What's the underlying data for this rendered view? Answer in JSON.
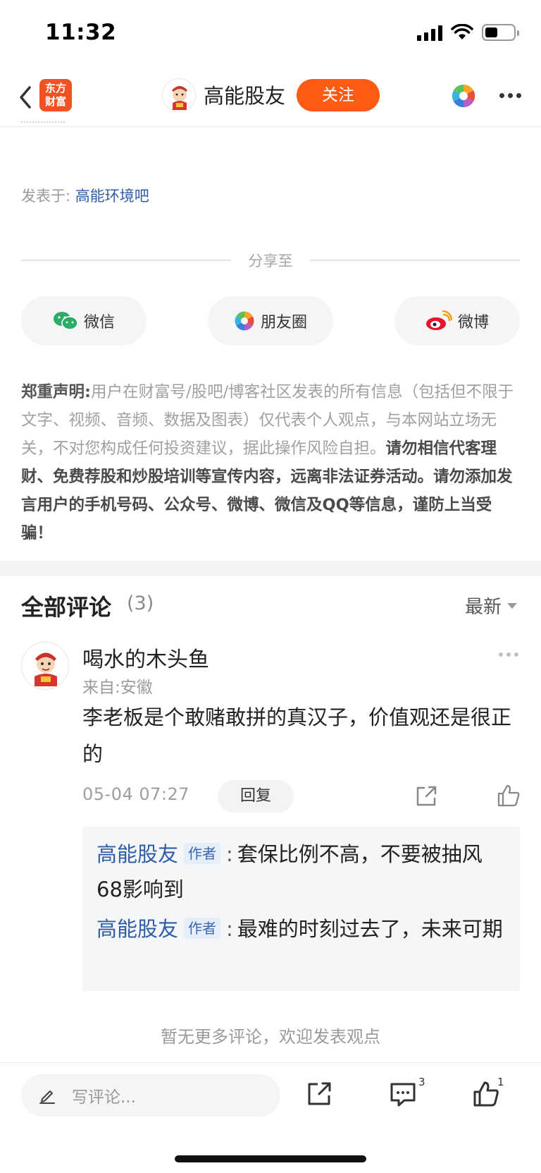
{
  "status_bar": {
    "time": "11:32"
  },
  "nav": {
    "app_logo_line1": "东方",
    "app_logo_line2": "财富",
    "account_name": "高能股友",
    "follow_label": "关注"
  },
  "post": {
    "posted_in_label": "发表于:",
    "posted_in_forum": "高能环境吧"
  },
  "share": {
    "title": "分享至",
    "targets": [
      {
        "label": "微信",
        "icon": "wechat-icon"
      },
      {
        "label": "朋友圈",
        "icon": "moments-icon"
      },
      {
        "label": "微博",
        "icon": "weibo-icon"
      }
    ]
  },
  "disclaimer": {
    "heading": "郑重声明:",
    "normal_text": "用户在财富号/股吧/博客社区发表的所有信息（包括但不限于文字、视频、音频、数据及图表）仅代表个人观点，与本网站立场无关，不对您构成任何投资建议，据此操作风险自担。",
    "bold_text": "请勿相信代客理财、免费荐股和炒股培训等宣传内容，远离非法证券活动。请勿添加发言用户的手机号码、公众号、微博、微信及QQ等信息，谨防上当受骗！"
  },
  "comments": {
    "title": "全部评论",
    "count": "(3)",
    "sort_label": "最新",
    "items": [
      {
        "user": "喝水的木头鱼",
        "location": "来自:安徽",
        "text": "李老板是个敢赌敢拼的真汉子，价值观还是很正的",
        "time": "05-04 07:27",
        "reply_label": "回复",
        "replies": [
          {
            "user": "高能股友",
            "tag": "作者",
            "text": "套保比例不高，不要被抽风68影响到"
          },
          {
            "user": "高能股友",
            "tag": "作者",
            "text": "最难的时刻过去了，未来可期"
          }
        ]
      }
    ],
    "no_more": "暂无更多评论，欢迎发表观点"
  },
  "bottom_bar": {
    "input_placeholder": "写评论...",
    "comment_badge": "3",
    "like_badge": "1"
  },
  "colors": {
    "brand_orange": "#ff5a14",
    "link_blue": "#2e5da6",
    "app_logo_red": "#ef5324"
  }
}
